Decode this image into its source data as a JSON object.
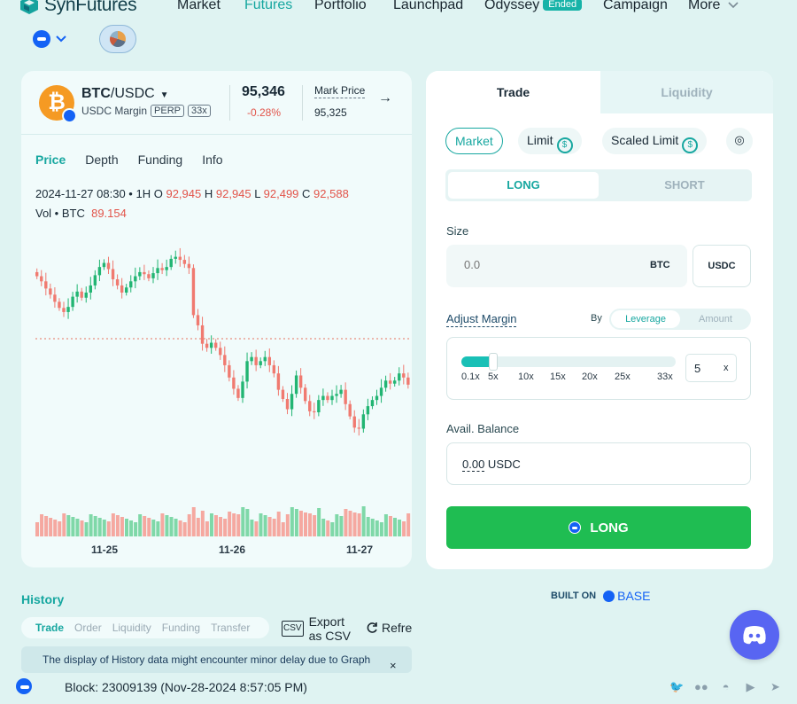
{
  "app": {
    "brand": "SynFutures"
  },
  "nav": {
    "items": [
      {
        "label": "Market",
        "active": false
      },
      {
        "label": "Futures",
        "active": true
      },
      {
        "label": "Portfolio",
        "active": false
      },
      {
        "label": "Launchpad",
        "active": false
      },
      {
        "label": "Odyssey",
        "active": false,
        "badge": "Ended"
      },
      {
        "label": "Campaign",
        "active": false
      },
      {
        "label": "More",
        "active": false
      }
    ]
  },
  "pair": {
    "base": "BTC",
    "quote": "/USDC",
    "margin_label": "USDC Margin",
    "tag_type": "PERP",
    "tag_leverage": "33x",
    "last_price": "95,346",
    "change": "-0.28%",
    "mark_label": "Mark Price",
    "mark_value": "95,325"
  },
  "chart_tabs": [
    "Price",
    "Depth",
    "Funding",
    "Info"
  ],
  "ohlc": {
    "time": "2024-11-27 08:30",
    "interval": "1H",
    "o_label": "O",
    "o": "92,945",
    "h_label": "H",
    "h": "92,945",
    "l_label": "L",
    "l": "92,499",
    "c_label": "C",
    "c": "92,588",
    "vol_label": "Vol • BTC",
    "vol": "89.154"
  },
  "chart_data": {
    "type": "candlestick",
    "x_ticks": [
      "11-25",
      "11-26",
      "11-27"
    ],
    "close": [
      98400,
      98150,
      97800,
      97500,
      97150,
      96850,
      96650,
      96900,
      97400,
      97650,
      97350,
      97600,
      97950,
      98450,
      98850,
      99050,
      98750,
      98250,
      97950,
      97600,
      97850,
      98150,
      98400,
      98600,
      98500,
      98300,
      98550,
      98800,
      98700,
      98850,
      99250,
      99350,
      99200,
      99000,
      98800,
      96500,
      96000,
      95100,
      94900,
      95150,
      94900,
      94550,
      94050,
      93450,
      92900,
      92450,
      93250,
      94250,
      94450,
      94050,
      94250,
      94450,
      94050,
      93650,
      92850,
      92400,
      91900,
      92650,
      93550,
      92950,
      92300,
      91800,
      91750,
      92350,
      92550,
      92350,
      92550,
      92650,
      92850,
      92150,
      91550,
      91000,
      90950,
      91650,
      92050,
      92350,
      92550,
      92950,
      93300,
      93150,
      93300,
      93650,
      93450,
      93100
    ],
    "volume_bars": 84,
    "ylim": [
      89800,
      100200
    ]
  },
  "history": {
    "title": "History",
    "tabs": [
      "Trade",
      "Order",
      "Liquidity",
      "Funding",
      "Transfer"
    ],
    "export_line1": "Export",
    "export_line2": "as CSV",
    "export_icon": "CSV",
    "refresh": "Refre",
    "notice": "The display of History data might encounter minor delay due to Graph",
    "close_icon": "×"
  },
  "trade": {
    "tab_trade": "Trade",
    "tab_liquidity": "Liquidity",
    "order_types": {
      "market": "Market",
      "limit": "Limit",
      "scaled": "Scaled Limit"
    },
    "side_long": "LONG",
    "side_short": "SHORT",
    "size_label": "Size",
    "size_placeholder": "0.0",
    "size_unit": "BTC",
    "size_currency": "USDC",
    "adjust_margin": "Adjust Margin",
    "by": "By",
    "mode_leverage": "Leverage",
    "mode_amount": "Amount",
    "leverage_ticks": [
      "0.1x",
      "5x",
      "10x",
      "15x",
      "20x",
      "25x",
      "33x"
    ],
    "leverage_value": "5",
    "leverage_suffix": "x",
    "leverage_fraction": 0.148,
    "avail_label": "Avail. Balance",
    "avail_amount": "0.00",
    "avail_currency": " USDC",
    "long_button": "LONG"
  },
  "built_on": {
    "label": "BUILT ON",
    "chain": "BASE"
  },
  "footer": {
    "block": "Block: 23009139 (Nov-28-2024 8:57:05 PM)",
    "socials": [
      "twitter-icon",
      "medium-icon",
      "discord-icon",
      "youtube-icon",
      "telegram-icon"
    ]
  },
  "colors": {
    "accent": "#17a7a0",
    "up": "#22b573",
    "down": "#f07a70",
    "long": "#1fbd52",
    "background": "#dff3f2"
  }
}
